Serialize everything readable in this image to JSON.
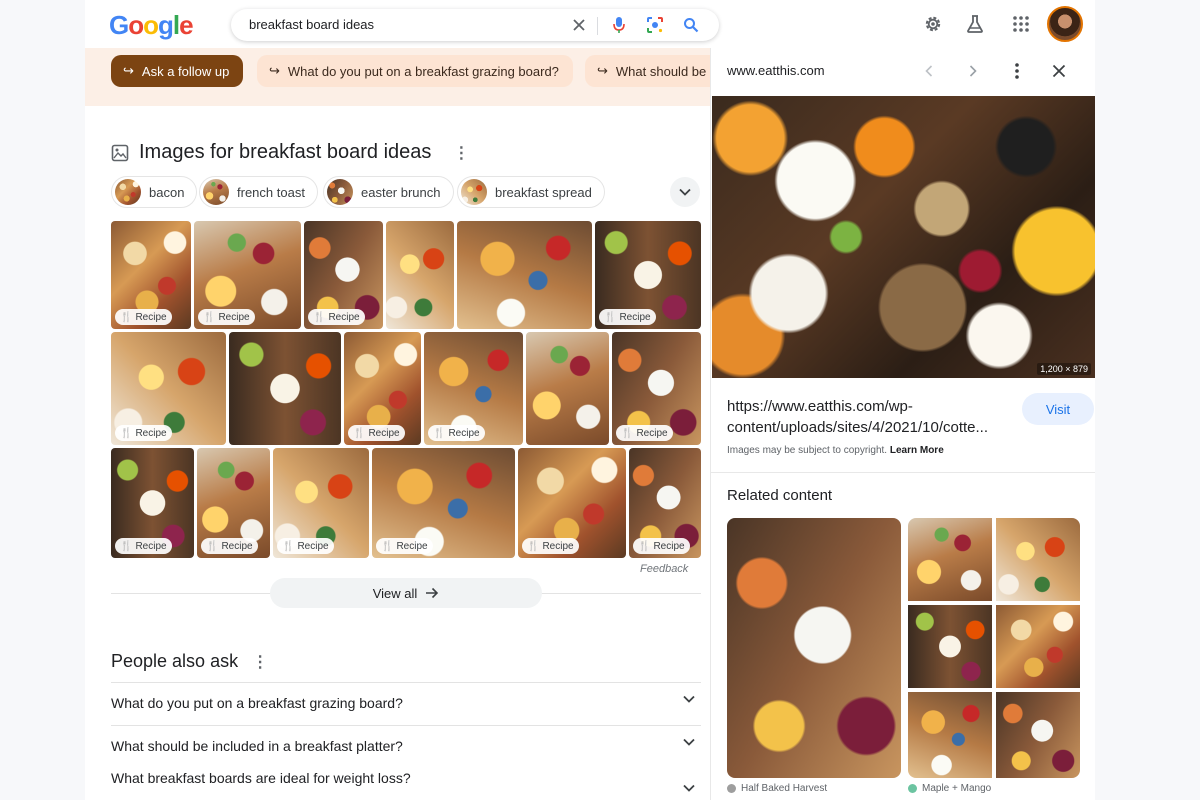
{
  "header": {
    "logo_letters": [
      "G",
      "o",
      "o",
      "g",
      "l",
      "e"
    ],
    "search_query": "breakfast board ideas"
  },
  "followups": [
    {
      "label": "Ask a follow up",
      "primary": true
    },
    {
      "label": "What do you put on a breakfast grazing board?",
      "primary": false
    },
    {
      "label": "What should be",
      "primary": false
    }
  ],
  "images": {
    "title": "Images for breakfast board ideas",
    "filters": [
      "bacon",
      "french toast",
      "easter brunch",
      "breakfast spread"
    ],
    "badge_label": "Recipe",
    "feedback": "Feedback",
    "view_all": "View all"
  },
  "people_also_ask": {
    "title": "People also ask",
    "questions": [
      "What do you put on a breakfast grazing board?",
      "What should be included in a breakfast platter?",
      "What breakfast boards are ideal for weight loss?"
    ]
  },
  "panel": {
    "domain": "www.eatthis.com",
    "image_dims": "1,200 × 879",
    "url": "https://www.eatthis.com/wp-content/uploads/sites/4/2021/10/cotte...",
    "visit": "Visit",
    "copyright": "Images may be subject to copyright.",
    "learn_more": "Learn More",
    "related_title": "Related content",
    "related_sources": [
      "Half Baked Harvest",
      "Maple + Mango"
    ]
  },
  "colors": {
    "accent_blue": "#1a73e8",
    "followup_primary": "#7c4412",
    "followup_bg": "#fde4d3"
  }
}
